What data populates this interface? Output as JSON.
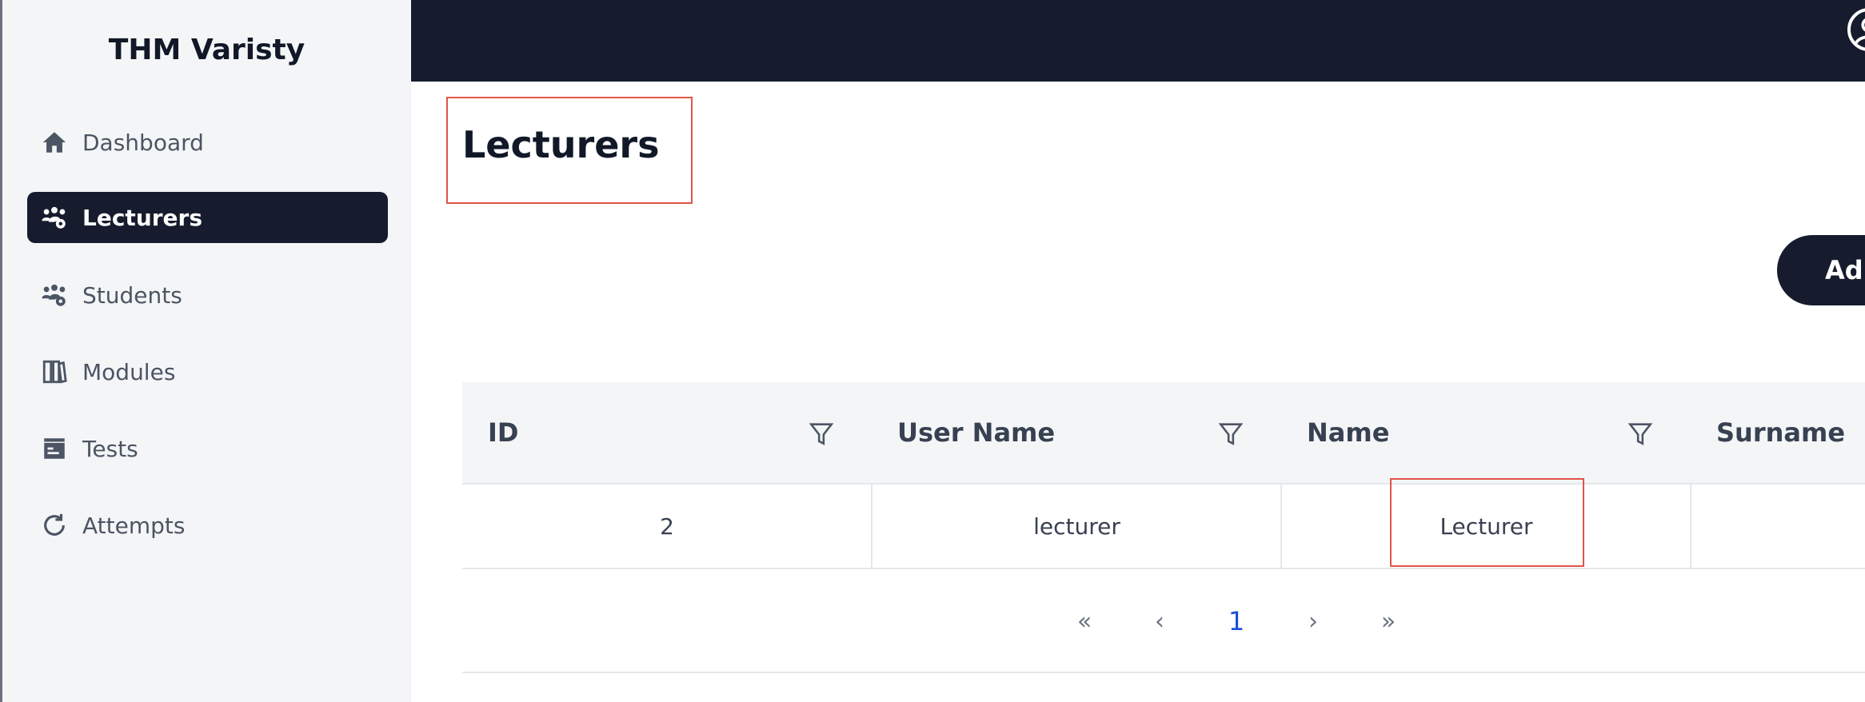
{
  "sidebar": {
    "brand": "THM Varisty",
    "items": [
      {
        "label": "Dashboard",
        "icon": "home-icon",
        "active": false
      },
      {
        "label": "Lecturers",
        "icon": "users-gear-icon",
        "active": true
      },
      {
        "label": "Students",
        "icon": "users-gear-icon",
        "active": false
      },
      {
        "label": "Modules",
        "icon": "books-icon",
        "active": false
      },
      {
        "label": "Tests",
        "icon": "id-card-icon",
        "active": false
      },
      {
        "label": "Attempts",
        "icon": "refresh-icon",
        "active": false
      }
    ]
  },
  "header": {
    "user_icon": "user-circle-icon"
  },
  "main": {
    "title": "Lecturers",
    "add_button_label": "Ad"
  },
  "table": {
    "columns": [
      "ID",
      "User Name",
      "Name",
      "Surname"
    ],
    "rows": [
      {
        "id": "2",
        "username": "lecturer",
        "name": "Lecturer",
        "surname": ""
      }
    ]
  },
  "pagination": {
    "first": "«",
    "prev": "‹",
    "current": "1",
    "next": "›",
    "last": "»"
  },
  "colors": {
    "dark": "#161c2d",
    "sidebar_bg": "#f4f5f7",
    "highlight_border": "#e0554a",
    "current_page": "#1d4ed8"
  }
}
